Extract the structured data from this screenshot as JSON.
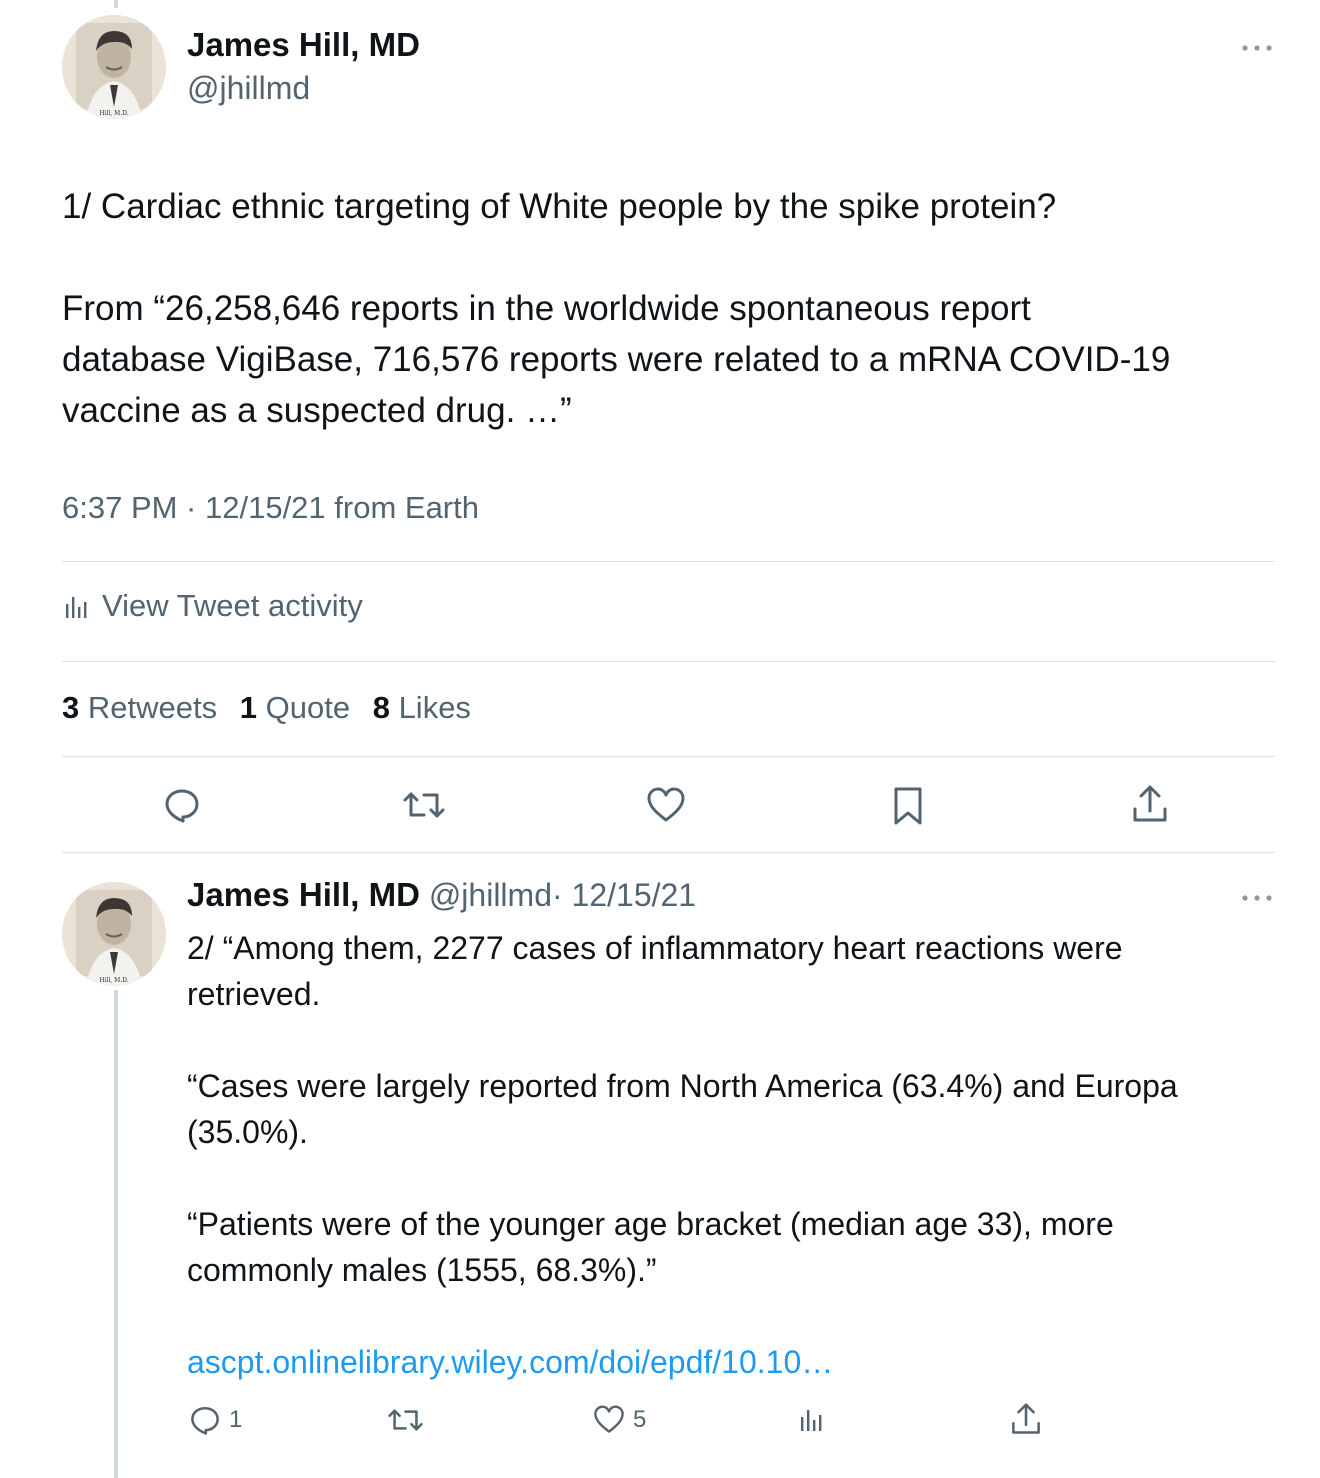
{
  "main_tweet": {
    "author_name": "James Hill, MD",
    "author_handle": "@jhillmd",
    "avatar_caption": "Hill, M.D.",
    "text_line1": "1/ Cardiac ethnic targeting of White people by the spike protein?",
    "text_line2": "From “26,258,646 reports in the worldwide spontaneous report",
    "text_line3": "database VigiBase, 716,576 reports were related to a mRNA COVID-19",
    "text_line4": "vaccine as a suspected drug. …”",
    "timestamp": "6:37 PM · 12/15/21 from Earth",
    "activity_label": "View Tweet activity",
    "stats": {
      "retweets_count": "3",
      "retweets_label": "Retweets",
      "quotes_count": "1",
      "quotes_label": "Quote",
      "likes_count": "8",
      "likes_label": "Likes"
    }
  },
  "reply_tweet": {
    "author_name": "James Hill, MD",
    "author_handle": "@jhillmd",
    "date": "· 12/15/21",
    "avatar_caption": "Hill, M.D.",
    "line1": "2/ “Among them, 2277 cases of inflammatory heart reactions were",
    "line2": "retrieved.",
    "line3": "“Cases were largely reported from North America (63.4%) and Europa",
    "line4": "(35.0%).",
    "line5": "“Patients were of the younger age bracket (median age 33), more",
    "line6": "commonly males (1555, 68.3%).”",
    "link": "ascpt.onlinelibrary.wiley.com/doi/epdf/10.10…",
    "reply_count": "1",
    "like_count": "5"
  },
  "colors": {
    "text_primary": "#0f1419",
    "text_secondary": "#536471",
    "link": "#1d9bf0",
    "divider": "#dbe1e5",
    "thread_line": "#cfd9de"
  },
  "icons": [
    "reply-icon",
    "retweet-icon",
    "like-icon",
    "bookmark-icon",
    "share-icon",
    "analytics-icon",
    "more-icon"
  ]
}
